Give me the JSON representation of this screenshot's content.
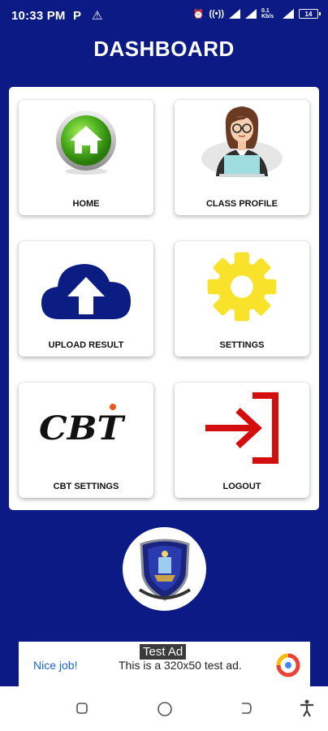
{
  "status_bar": {
    "time": "10:33 PM",
    "p_badge": "P",
    "warning": "⚠",
    "net_speed": "0.1 Kb/s",
    "battery": "14"
  },
  "header": {
    "title": "DASHBOARD"
  },
  "tiles": [
    {
      "label": "HOME",
      "icon": "home-icon"
    },
    {
      "label": "CLASS PROFILE",
      "icon": "teacher-icon"
    },
    {
      "label": "UPLOAD RESULT",
      "icon": "cloud-upload-icon"
    },
    {
      "label": "SETTINGS",
      "icon": "gear-icon"
    },
    {
      "label": "CBT SETTINGS",
      "icon": "cbt-logo-icon",
      "logo_text": "CBT"
    },
    {
      "label": "LOGOUT",
      "icon": "logout-icon"
    }
  ],
  "ad": {
    "tag": "Test Ad",
    "nice": "Nice job!",
    "text": "This is a 320x50 test ad."
  },
  "colors": {
    "background": "#0c1a86",
    "home_green": "#4caf1e",
    "upload_navy": "#0b1c83",
    "settings_yellow": "#f8e22a",
    "logout_red": "#d40d0d"
  }
}
